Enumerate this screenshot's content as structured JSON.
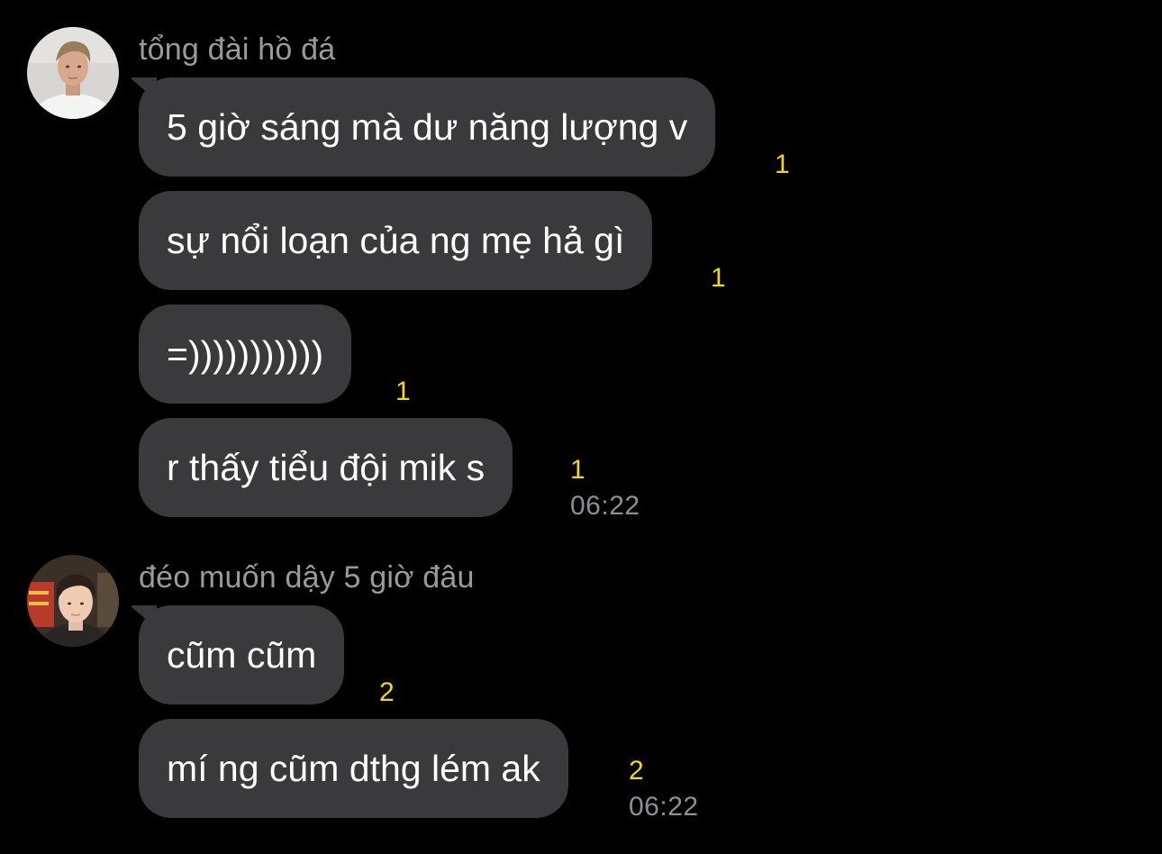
{
  "colors": {
    "background": "#000000",
    "bubble": "#3a3a3c",
    "unread": "#f5d90a",
    "sender_name": "#9a9a9e",
    "timestamp": "#8e8e93"
  },
  "groups": [
    {
      "sender": "tổng đài hồ đá",
      "avatar_icon": "avatar-photo",
      "messages": [
        {
          "text": "5 giờ sáng mà dư năng lượng v",
          "unread": "1"
        },
        {
          "text": "sự nổi loạn của ng mẹ hả gì",
          "unread": "1"
        },
        {
          "text": "=)))))))))))",
          "unread": "1"
        },
        {
          "text": "r thấy tiểu đội mik s",
          "unread": "1",
          "time": "06:22"
        }
      ]
    },
    {
      "sender": "đéo muốn dậy 5 giờ đâu",
      "avatar_icon": "avatar-photo",
      "messages": [
        {
          "text": "cũm cũm",
          "unread": "2"
        },
        {
          "text": "mí ng cũm dthg lém ak",
          "unread": "2",
          "time": "06:22"
        }
      ]
    }
  ]
}
